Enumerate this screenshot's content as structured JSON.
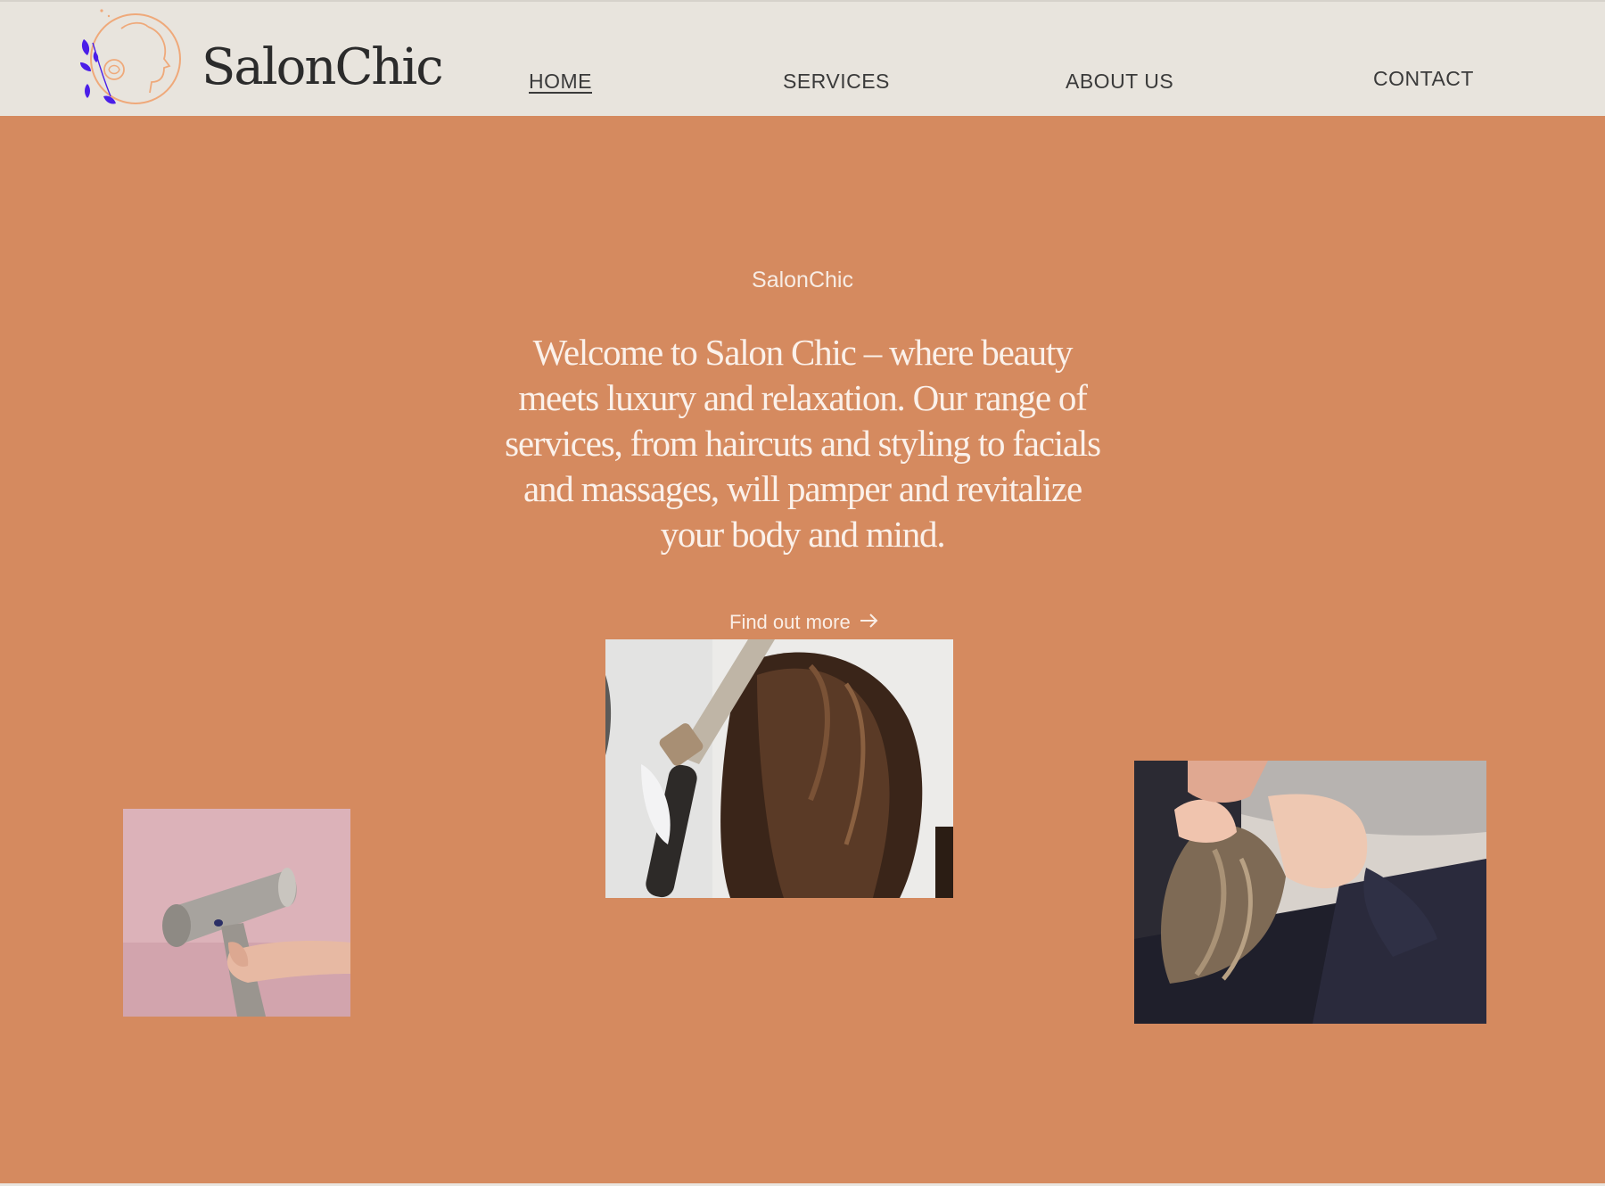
{
  "brand": {
    "name": "SalonChic",
    "logo_icon": "woman-face-with-rose-and-leaves-icon"
  },
  "nav": {
    "items": [
      {
        "label": "HOME",
        "active": true
      },
      {
        "label": "SERVICES",
        "active": false
      },
      {
        "label": "ABOUT US",
        "active": false
      },
      {
        "label": "CONTACT",
        "active": false
      }
    ]
  },
  "hero": {
    "eyebrow": "SalonChic",
    "text": "Welcome to Salon Chic – where beauty meets luxury and relaxation. Our range of services, from haircuts and styling to facials and massages, will pamper and revitalize your body and mind.",
    "cta_label": "Find out more",
    "cta_icon": "arrow-right-icon"
  },
  "images": [
    {
      "name": "hair-curling-photo"
    },
    {
      "name": "hair-dryer-photo"
    },
    {
      "name": "hair-washing-photo"
    }
  ],
  "colors": {
    "header_bg": "#e8e4dd",
    "hero_bg": "#d58a5f",
    "logo_accent": "#4a1ee8",
    "logo_line": "#efa97a"
  }
}
